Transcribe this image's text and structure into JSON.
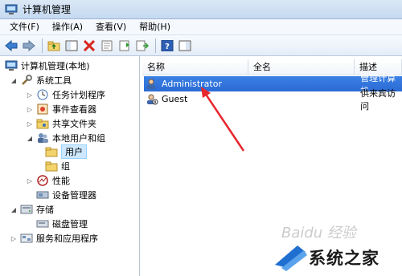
{
  "window": {
    "title": "计算机管理"
  },
  "menu": {
    "items": [
      "文件(F)",
      "操作(A)",
      "查看(V)",
      "帮助(H)"
    ]
  },
  "tree": {
    "root": "计算机管理(本地)",
    "system_tools": "系统工具",
    "task_scheduler": "任务计划程序",
    "event_viewer": "事件查看器",
    "shared_folders": "共享文件夹",
    "local_users": "本地用户和组",
    "users": "用户",
    "groups": "组",
    "performance": "性能",
    "device_manager": "设备管理器",
    "storage": "存储",
    "disk_management": "磁盘管理",
    "services_apps": "服务和应用程序"
  },
  "table": {
    "columns": [
      "名称",
      "全名",
      "描述"
    ],
    "rows": [
      {
        "name": "Administrator",
        "fullname": "",
        "desc": "管理计算机",
        "selected": true
      },
      {
        "name": "Guest",
        "fullname": "",
        "desc": "供来宾访问",
        "selected": false
      }
    ]
  },
  "watermark": {
    "text": "系统之家",
    "baidu": "Baidu 经验"
  },
  "colors": {
    "selection": "#2b6bd4",
    "arrow": "#e8262d",
    "titlebar": "#dbe8f6"
  }
}
